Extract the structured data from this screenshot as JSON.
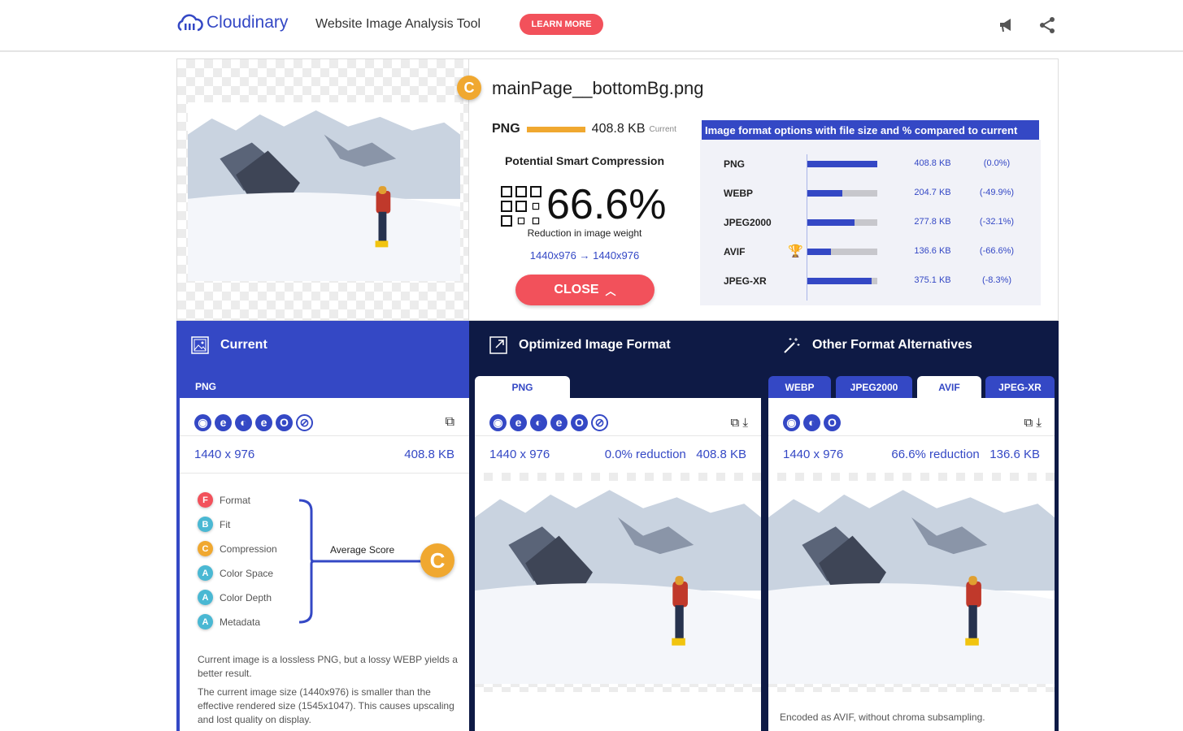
{
  "header": {
    "logo": "Cloudinary",
    "title": "Website Image Analysis Tool",
    "learn_more": "LEARN MORE",
    "icons": [
      "megaphone-icon",
      "share-icon"
    ]
  },
  "summary": {
    "grade": "C",
    "filename": "mainPage__bottomBg.png",
    "current_format": "PNG",
    "current_size": "408.8 KB",
    "current_label": "Current",
    "psc_title": "Potential Smart Compression",
    "reduction": "66.6%",
    "reduction_label": "Reduction in image weight",
    "dims_from": "1440x976",
    "dims_arrow": "→",
    "dims_to": "1440x976",
    "close": "CLOSE"
  },
  "format_table": {
    "title": "Image format options with file size and % compared to current",
    "rows": [
      {
        "format": "PNG",
        "size": "408.8 KB",
        "pct": "(0.0%)",
        "ratio": 1.0,
        "best": false
      },
      {
        "format": "WEBP",
        "size": "204.7 KB",
        "pct": "(-49.9%)",
        "ratio": 0.501,
        "best": false
      },
      {
        "format": "JPEG2000",
        "size": "277.8 KB",
        "pct": "(-32.1%)",
        "ratio": 0.679,
        "best": false
      },
      {
        "format": "AVIF",
        "size": "136.6 KB",
        "pct": "(-66.6%)",
        "ratio": 0.334,
        "best": true
      },
      {
        "format": "JPEG-XR",
        "size": "375.1 KB",
        "pct": "(-8.3%)",
        "ratio": 0.917,
        "best": false
      }
    ]
  },
  "current": {
    "title": "Current",
    "tab": "PNG",
    "dims": "1440 x 976",
    "size": "408.8 KB",
    "scores": [
      {
        "grade": "F",
        "label": "Format",
        "color": "#f2515b"
      },
      {
        "grade": "B",
        "label": "Fit",
        "color": "#4ab8d3"
      },
      {
        "grade": "C",
        "label": "Compression",
        "color": "#f0a830"
      },
      {
        "grade": "A",
        "label": "Color Space",
        "color": "#4ab8d3"
      },
      {
        "grade": "A",
        "label": "Color Depth",
        "color": "#4ab8d3"
      },
      {
        "grade": "A",
        "label": "Metadata",
        "color": "#4ab8d3"
      }
    ],
    "average_label": "Average Score",
    "average_grade": "C",
    "note1": "Current image is a lossless PNG, but a lossy WEBP yields a better result.",
    "note2": "The current image size (1440x976) is smaller than the effective rendered size (1545x1047). This causes upscaling and lost quality on display."
  },
  "optimized": {
    "title": "Optimized Image Format",
    "tab": "PNG",
    "dims": "1440 x 976",
    "reduction": "0.0% reduction",
    "size": "408.8 KB"
  },
  "alternatives": {
    "title": "Other Format Alternatives",
    "tabs": [
      "WEBP",
      "JPEG2000",
      "AVIF",
      "JPEG-XR"
    ],
    "active_tab": "AVIF",
    "dims": "1440 x 976",
    "reduction": "66.6% reduction",
    "size": "136.6 KB",
    "note": "Encoded as AVIF, without chroma subsampling."
  },
  "colors": {
    "brand": "#3448c5",
    "navy": "#0e1a45",
    "accent": "#f2515b",
    "grade_c": "#f0a830"
  }
}
